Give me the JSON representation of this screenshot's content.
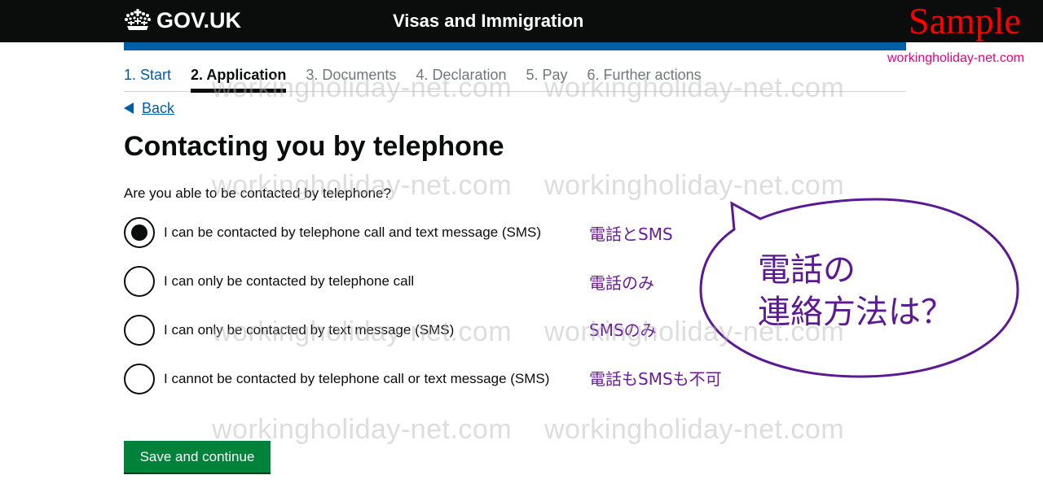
{
  "header": {
    "logo_text": "GOV.UK",
    "service_name": "Visas and Immigration",
    "sample_label": "Sample",
    "site_url": "workingholiday-net.com"
  },
  "steps": [
    {
      "label": "1. Start",
      "state": "done"
    },
    {
      "label": "2. Application",
      "state": "current"
    },
    {
      "label": "3. Documents",
      "state": "upcoming"
    },
    {
      "label": "4. Declaration",
      "state": "upcoming"
    },
    {
      "label": "5. Pay",
      "state": "upcoming"
    },
    {
      "label": "6. Further actions",
      "state": "upcoming"
    }
  ],
  "back_label": "Back",
  "page_title": "Contacting you by telephone",
  "question": "Are you able to be contacted by telephone?",
  "options": [
    {
      "label": "I can be contacted by telephone call and text message (SMS)",
      "checked": true,
      "note": "電話とSMS"
    },
    {
      "label": "I can only be contacted by telephone call",
      "checked": false,
      "note": "電話のみ"
    },
    {
      "label": "I can only be contacted by text message (SMS)",
      "checked": false,
      "note": "SMSのみ"
    },
    {
      "label": "I cannot be contacted by telephone call or text message (SMS)",
      "checked": false,
      "note": "電話もSMSも不可"
    }
  ],
  "bubble": {
    "line1": "電話の",
    "line2": "連絡方法は？"
  },
  "save_button": "Save and continue",
  "watermark": "workingholiday-net.com",
  "colors": {
    "header_bg": "#0b0c0c",
    "brand_blue": "#005ea5",
    "button_green": "#00823b",
    "annotation_purple": "#6a1b9a",
    "sample_red": "#ff0000",
    "url_pink": "#e5007e"
  }
}
